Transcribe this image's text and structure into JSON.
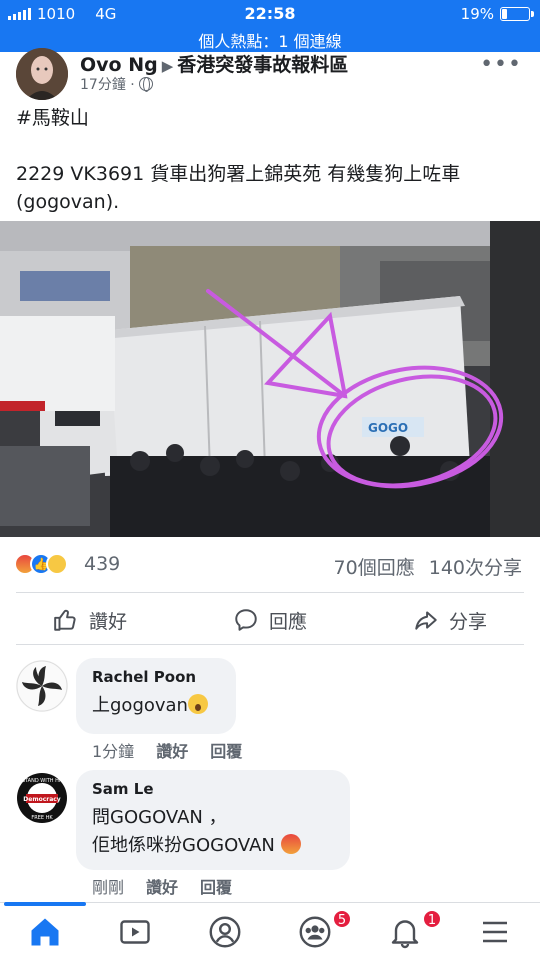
{
  "status_bar": {
    "carrier": "1010",
    "network": "4G",
    "time": "22:58",
    "battery": "19%",
    "battery_level": 0.19,
    "hotspot": "個人熱點：1 個連線"
  },
  "post": {
    "author": "Ovo Ng",
    "group": "香港突發事故報料區",
    "time_ago": "17分鐘 ·",
    "hashtag": "#馬鞍山",
    "body": "2229 VK3691 貨車出狗署上錦英苑 有幾隻狗上咗車 (gogovan).",
    "image_text": "GOGO",
    "reaction_count": "439",
    "comments_count": "70個回應",
    "shares_count": "140次分享"
  },
  "actions": {
    "like": "讚好",
    "comment": "回應",
    "share": "分享"
  },
  "comments": [
    {
      "name": "Rachel Poon",
      "text": "上gogovan",
      "time": "1分鐘",
      "like": "讚好",
      "reply": "回覆"
    },
    {
      "name": "Sam Le",
      "line1": "問GOGOVAN ，",
      "line2": "佢地係咪扮GOGOVAN",
      "time": "剛剛",
      "like": "讚好",
      "reply": "回覆",
      "avatar_text_top": "STAND WITH HK",
      "avatar_text_mid": "Democracy",
      "avatar_text_bottom": "FREE HK"
    }
  ],
  "tabbar": {
    "groups_badge": "5",
    "notifications_badge": "1"
  },
  "colors": {
    "brand": "#1877f2",
    "badge": "#e41e3f",
    "annotation": "#c85be0"
  }
}
